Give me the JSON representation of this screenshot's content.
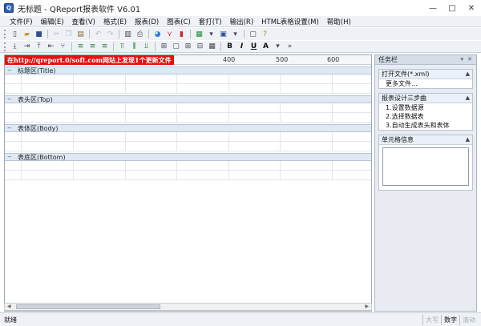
{
  "window": {
    "title": "无标题 - QReport报表软件 V6.01",
    "controls": [
      "—",
      "□",
      "✕"
    ]
  },
  "menu": [
    "文件(F)",
    "编辑(E)",
    "查看(V)",
    "格式(E)",
    "报表(D)",
    "图表(C)",
    "套打(T)",
    "输出(R)",
    "HTML表格设置(M)",
    "帮助(H)"
  ],
  "toolbar": {
    "bold_label": "B",
    "italic_label": "I",
    "underline_label": "U"
  },
  "ruler": {
    "banner": "在http://qreport.0/soft.com网站上发现1个更新文件",
    "ticks": [
      "400",
      "500",
      "600"
    ]
  },
  "bands": [
    {
      "toggle": "−",
      "title": "标题区(Title)"
    },
    {
      "toggle": "−",
      "title": "表头区(Top)"
    },
    {
      "toggle": "−",
      "title": "表体区(Body)"
    },
    {
      "toggle": "−",
      "title": "表底区(Bottom)"
    }
  ],
  "taskpane": {
    "header": "任务栏",
    "sections": [
      {
        "title": "打开文件(*.xml)",
        "items": [
          "更多文件..."
        ]
      },
      {
        "title": "报表设计三步曲",
        "items": [
          "1.设置数据源",
          "2.选择数据表",
          "3.自动生成表头和表体"
        ]
      },
      {
        "title": "单元格信息",
        "items": []
      }
    ]
  },
  "status": {
    "text": "就绪",
    "keys": [
      {
        "label": "大写",
        "active": false
      },
      {
        "label": "数字",
        "active": true
      },
      {
        "label": "滚动",
        "active": false
      }
    ]
  }
}
